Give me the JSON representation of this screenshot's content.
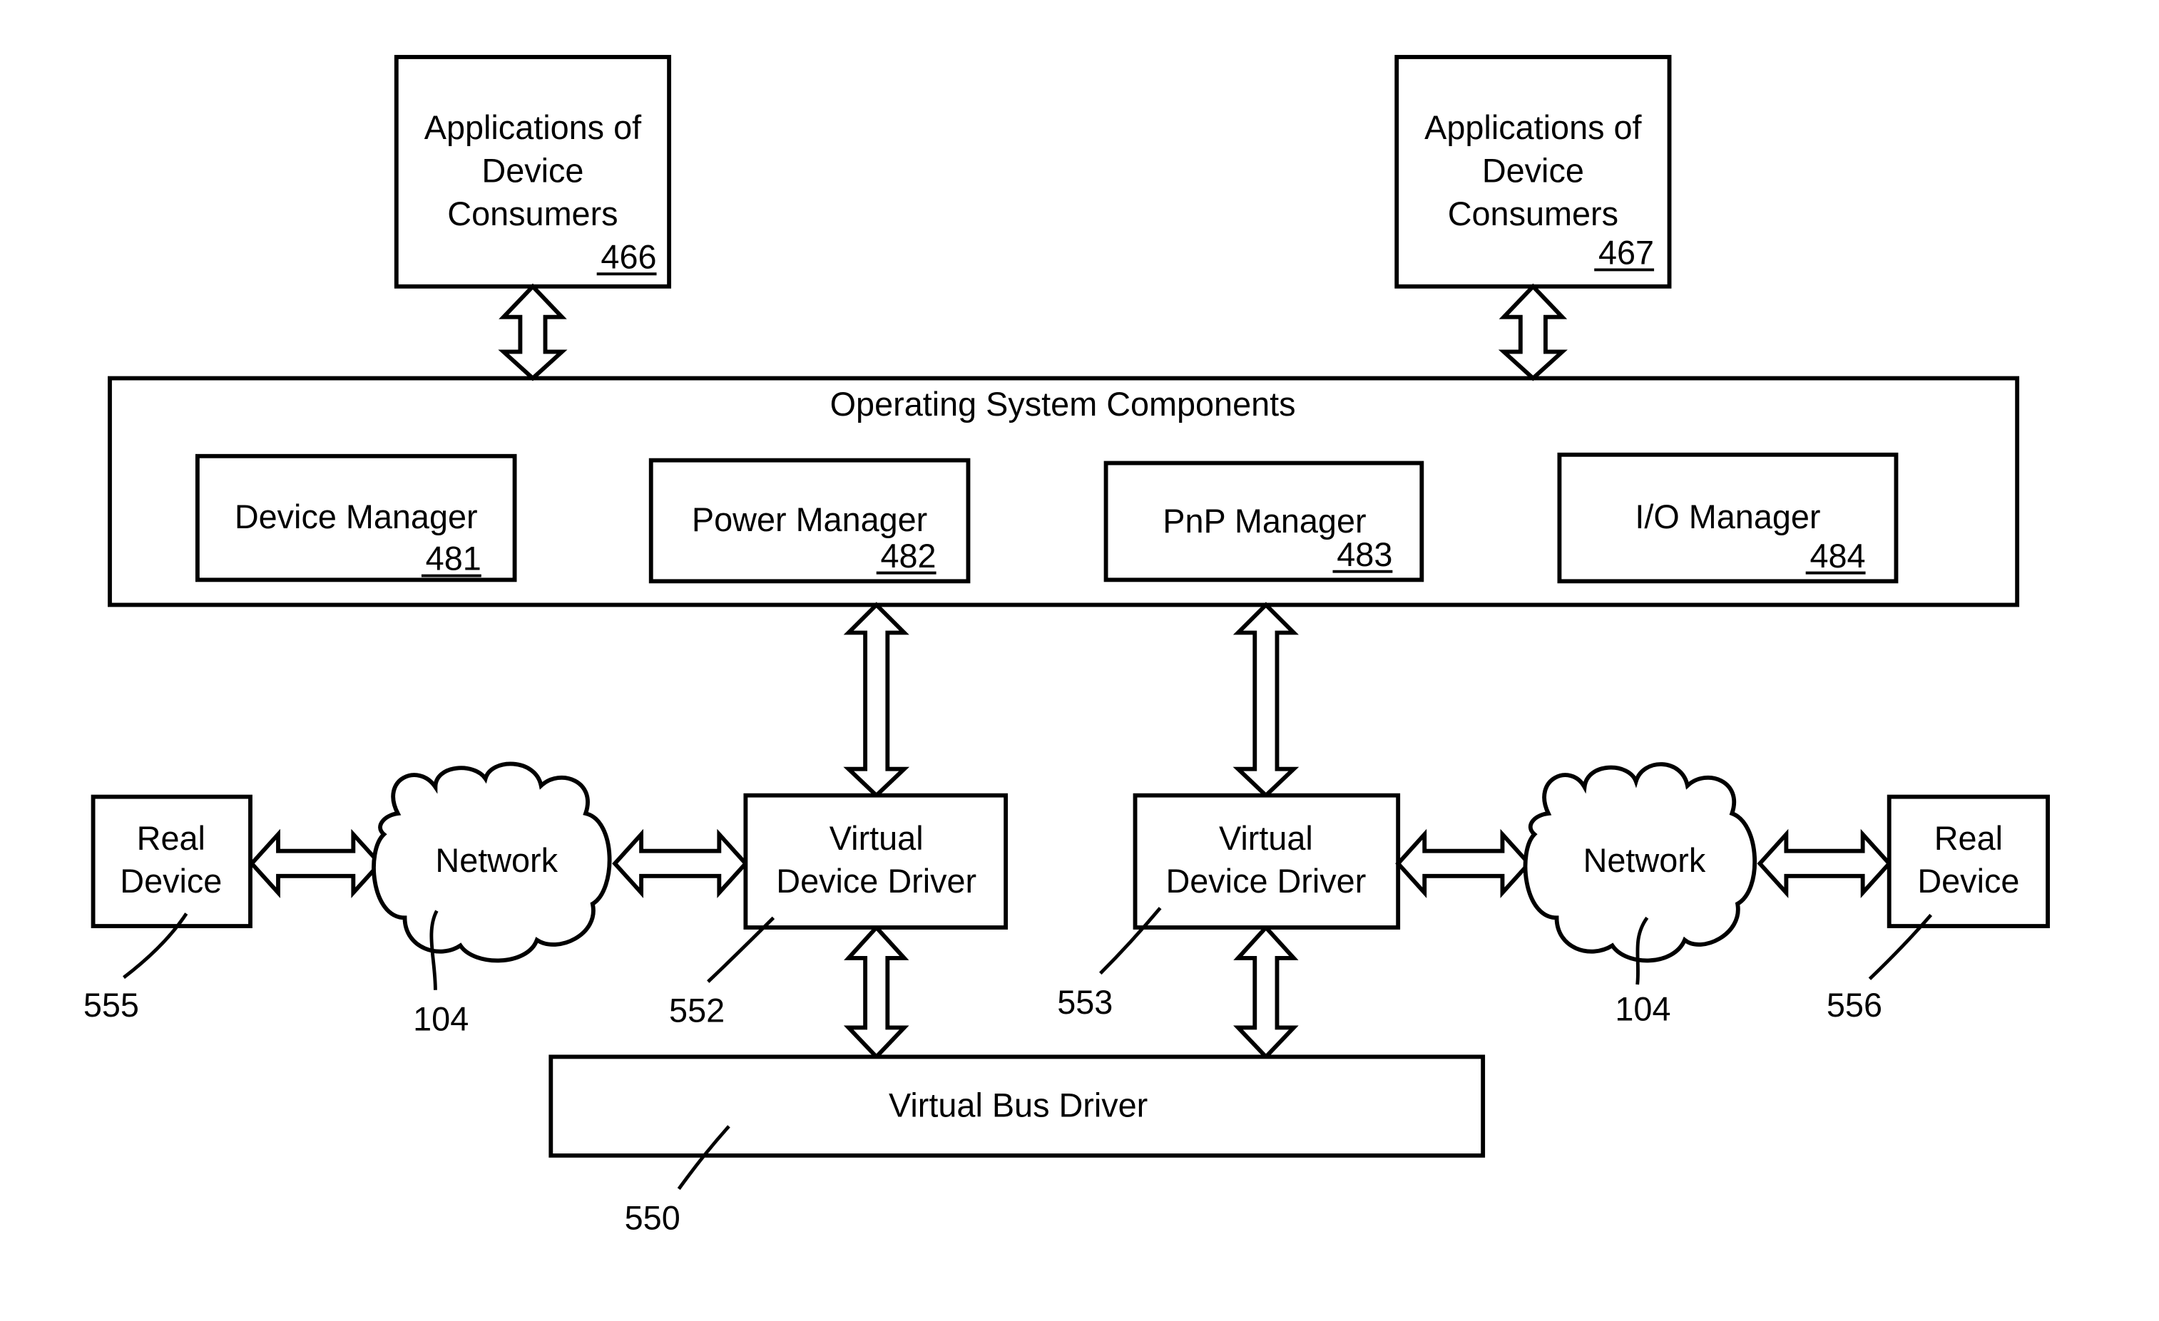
{
  "diagram": {
    "apps_left": {
      "lines": [
        "Applications of",
        "Device",
        "Consumers"
      ],
      "ref": "466"
    },
    "apps_right": {
      "lines": [
        "Applications of",
        "Device",
        "Consumers"
      ],
      "ref": "467"
    },
    "os": {
      "title": "Operating System Components",
      "components": [
        {
          "label": "Device Manager",
          "ref": "481"
        },
        {
          "label": "Power Manager",
          "ref": "482"
        },
        {
          "label": "PnP Manager",
          "ref": "483"
        },
        {
          "label": "I/O Manager",
          "ref": "484"
        }
      ]
    },
    "real_device_left": {
      "lines": [
        "Real",
        "Device"
      ],
      "ref": "555"
    },
    "network_left": {
      "label": "Network",
      "ref": "104"
    },
    "vdd_left": {
      "lines": [
        "Virtual",
        "Device Driver"
      ],
      "ref": "552"
    },
    "vdd_right": {
      "lines": [
        "Virtual",
        "Device Driver"
      ],
      "ref": "553"
    },
    "network_right": {
      "label": "Network",
      "ref": "104"
    },
    "real_device_right": {
      "lines": [
        "Real",
        "Device"
      ],
      "ref": "556"
    },
    "bus": {
      "label": "Virtual Bus Driver",
      "ref": "550"
    }
  }
}
